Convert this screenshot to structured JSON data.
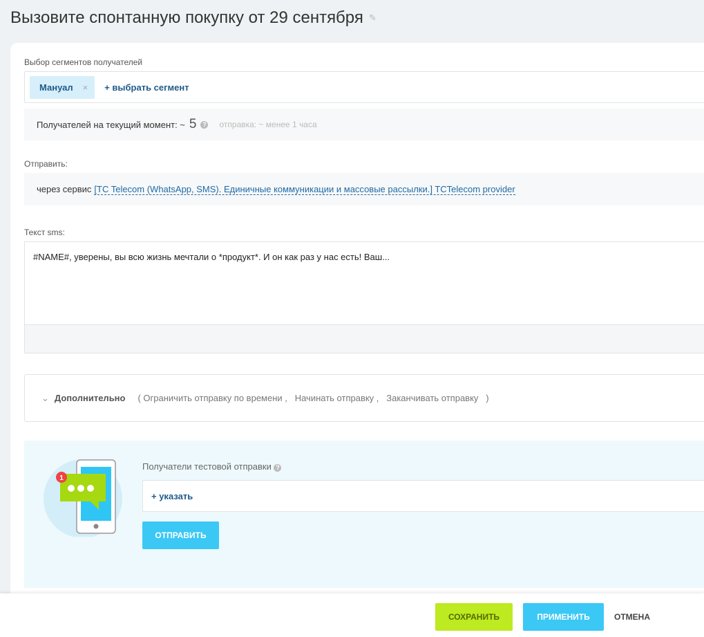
{
  "title": "Вызовите спонтанную покупку от 29 сентября",
  "segments": {
    "label": "Выбор сегментов получателей",
    "chips": [
      "Мануал"
    ],
    "add": "+ выбрать сегмент"
  },
  "recipients": {
    "label": "Получателей на текущий момент: ~",
    "count": "5",
    "sending": "отправка: ~ менее 1 часа"
  },
  "send": {
    "label": "Отправить:",
    "via": "через сервис",
    "service": "[TC Telecom (WhatsApp, SMS). Единичные коммуникации и массовые рассылки.] TCTelecom provider"
  },
  "sms": {
    "label": "Текст sms:",
    "text": "#NAME#, уверены, вы всю жизнь мечтали о *продукт*. И он как раз у нас есть! Ваш..."
  },
  "extra": {
    "title": "Дополнительно",
    "options": "( Ограничить отправку по времени ,   Начинать отправку ,   Заканчивать отправку   )"
  },
  "test": {
    "label": "Получатели тестовой отправки",
    "add": "+ указать",
    "send": "ОТПРАВИТЬ",
    "badge": "1"
  },
  "footer": {
    "save": "СОХРАНИТЬ",
    "apply": "ПРИМЕНИТЬ",
    "cancel": "ОТМЕНА"
  },
  "colors": {
    "save": "#bdea20",
    "apply": "#3bc8f5",
    "link": "#1f5a8a"
  }
}
